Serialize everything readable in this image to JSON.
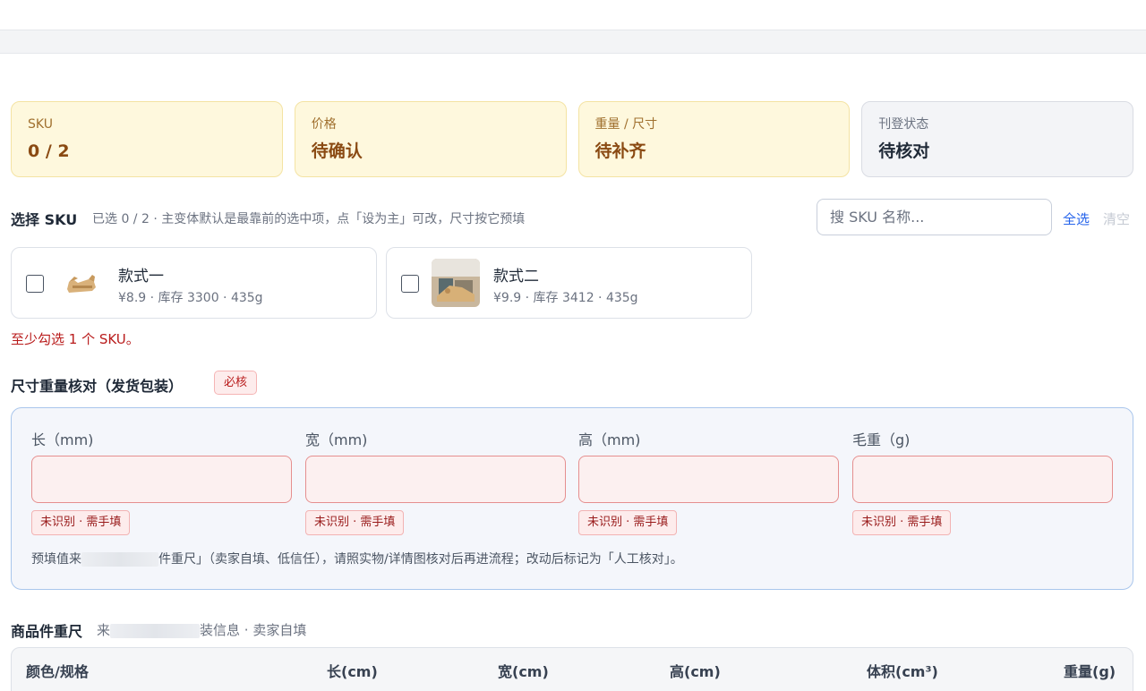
{
  "summary": [
    {
      "label": "SKU",
      "value": "0 / 2",
      "tone": "warn"
    },
    {
      "label": "价格",
      "value": "待确认",
      "tone": "warn"
    },
    {
      "label": "重量 / 尺寸",
      "value": "待补齐",
      "tone": "warn"
    },
    {
      "label": "刊登状态",
      "value": "待核对",
      "tone": "neutral"
    }
  ],
  "select_sku": {
    "title": "选择 SKU",
    "hint": "已选 0 / 2 · 主变体默认是最靠前的选中项，点「设为主」可改，尺寸按它预填",
    "search_placeholder": "搜 SKU 名称...",
    "select_all": "全选",
    "clear": "清空",
    "items": [
      {
        "name": "款式一",
        "meta": "¥8.9 · 库存 3300 · 435g",
        "checked": false
      },
      {
        "name": "款式二",
        "meta": "¥9.9 · 库存 3412 · 435g",
        "checked": false
      }
    ],
    "error": "至少勾选 1 个 SKU。"
  },
  "size_weight": {
    "title": "尺寸重量核对（发货包装）",
    "badge": "必核",
    "fields": [
      {
        "label": "长（mm)",
        "value": "",
        "tag": "未识别 · 需手填"
      },
      {
        "label": "宽（mm)",
        "value": "",
        "tag": "未识别 · 需手填"
      },
      {
        "label": "高（mm)",
        "value": "",
        "tag": "未识别 · 需手填"
      },
      {
        "label": "毛重（g)",
        "value": "",
        "tag": "未识别 · 需手填"
      }
    ],
    "note_prefix": "预填值来",
    "note_suffix": "件重尺」（卖家自填、低信任），请照实物/详情图核对后再进流程；改动后标记为「人工核对」。"
  },
  "goods_dims": {
    "title": "商品件重尺",
    "sub_prefix": "来",
    "sub_suffix": "装信息 · 卖家自填",
    "columns": [
      "颜色/规格",
      "长(cm)",
      "宽(cm)",
      "高(cm)",
      "体积(cm³)",
      "重量(g)"
    ]
  }
}
